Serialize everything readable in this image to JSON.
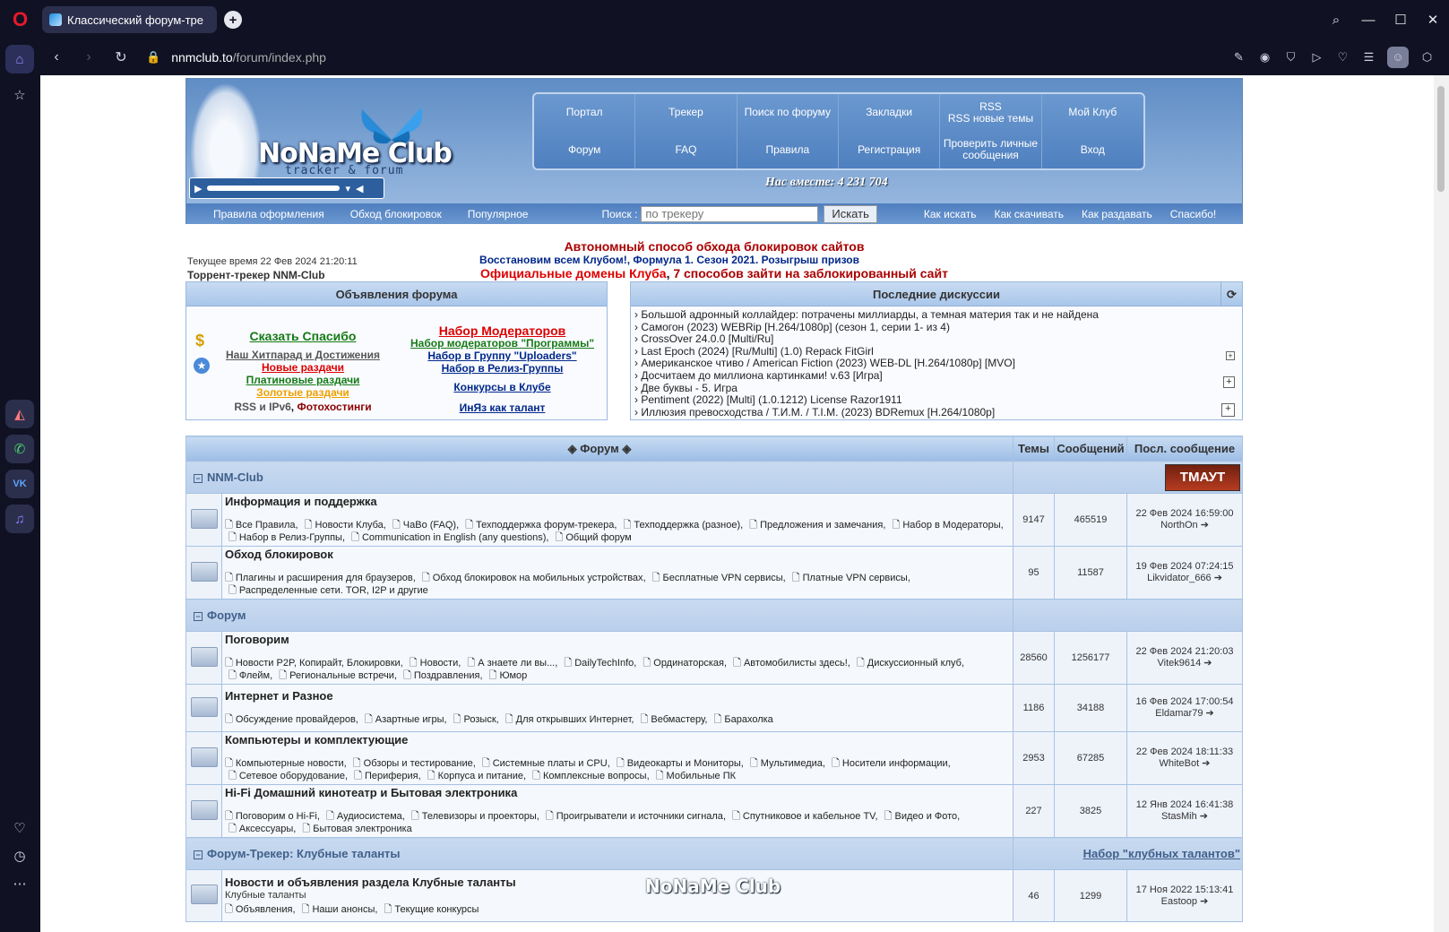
{
  "browser": {
    "tab_title": "Классический форум-тре",
    "url_host": "nnmclub.to",
    "url_path": "/forum/index.php",
    "new_tab": "+"
  },
  "header": {
    "logo": "NoNaMe Club",
    "logo_sub": "tracker & forum",
    "together": "Нас вместе: 4 231 704",
    "menu": [
      "Портал",
      "Трекер",
      "Поиск по форуму",
      "Закладки",
      "RSS\nRSS новые темы",
      "Мой Клуб",
      "Форум",
      "FAQ",
      "Правила",
      "Регистрация",
      "Проверить личные сообщения",
      "Вход"
    ],
    "subnav": [
      "Правила оформления",
      "Обход блокировок",
      "Популярное"
    ],
    "search_label": "Поиск :",
    "search_placeholder": "по трекеру",
    "search_btn": "Искать",
    "subnav_right": [
      "Как искать",
      "Как скачивать",
      "Как раздавать",
      "Спасибо!"
    ]
  },
  "info": {
    "time": "Текущее время 22 Фев 2024 21:20:11",
    "tracker": "Торрент-трекер NNM-Club",
    "ann1": "Автономный способ обхода блокировок сайтов",
    "ann2a": "Восстановим всем Клубом!",
    "ann2b": "Формула 1. Сезон 2021. Розыгрыш призов",
    "ann3a": "Официальные домены Клуба",
    "ann3b": "7 способов зайти на заблокированный сайт"
  },
  "announce": {
    "title": "Объявления форума",
    "col1": [
      "Сказать Спасибо",
      "Наш Хитпарад и Достижения",
      "Новые раздачи",
      "Платиновые раздачи",
      "Золотые раздачи"
    ],
    "rss": "RSS и IPv6",
    "photo": "Фотохостинги",
    "col2": [
      "Набор Модераторов",
      "Набор модераторов \"Программы\"",
      "Набор в Группу \"Uploaders\"",
      "Набор в Релиз-Группы",
      "Конкурсы в Клубе",
      "ИнЯз как талант"
    ]
  },
  "discussions": {
    "title": "Последние дискуссии",
    "items": [
      "Большой адронный коллайдер: потрачены миллиарды, а темная материя так и не найдена",
      "Самогон (2023) WEBRip [H.264/1080p] (сезон 1, серии 1- из 4)",
      "CrossOver 24.0.0 [Multi/Ru]",
      "Last Epoch (2024) [Ru/Multi] (1.0) Repack FitGirl",
      "Американское чтиво / American Fiction (2023) WEB-DL [H.264/1080p] [MVO]",
      "Досчитаем до миллиона картинками! v.63 [Игра]",
      "Две буквы - 5. Игра",
      "Pentiment (2022) [Multi] (1.0.1212) License Razor1911",
      "Иллюзия превосходства / Т.И.М. / T.I.M. (2023) BDRemux [H.264/1080p]"
    ]
  },
  "forum": {
    "col_forum": "Форум",
    "col_topics": "Темы",
    "col_posts": "Сообщений",
    "col_last": "Посл. сообщение",
    "cat1": "NNM-Club",
    "cat1_badge": "ТМАУТ",
    "cat2": "Форум",
    "cat3": "Форум-Трекер: Клубные таланты",
    "cat3_link": "Набор \"клубных талантов\"",
    "rows": [
      {
        "title": "Информация и поддержка",
        "subs": [
          "Все Правила",
          "Новости Клуба",
          "ЧаВо (FAQ)",
          "Техподдержка форум-трекера",
          "Техподдержка (разное)",
          "Предложения и замечания",
          "Набор в Модераторы",
          "Набор в Релиз-Группы",
          "Communication in English (any questions)",
          "Общий форум"
        ],
        "topics": "9147",
        "posts": "465519",
        "last_date": "22 Фев 2024 16:59:00",
        "last_user": "NorthOn"
      },
      {
        "title": "Обход блокировок",
        "subs": [
          "Плагины и расширения для браузеров",
          "Обход блокировок на мобильных устройствах",
          "Бесплатные VPN сервисы",
          "Платные VPN сервисы",
          "Распределенные сети. TOR, I2P и другие"
        ],
        "topics": "95",
        "posts": "11587",
        "last_date": "19 Фев 2024 07:24:15",
        "last_user": "Likvidator_666"
      },
      {
        "title": "Поговорим",
        "subs": [
          "Новости P2P, Копирайт, Блокировки",
          "Новости",
          "А знаете ли вы...",
          "DailyTechInfo",
          "Ординаторская",
          "Автомобилисты здесь!",
          "Дискуссионный клуб",
          "Флейм",
          "Региональные встречи",
          "Поздравления",
          "Юмор"
        ],
        "topics": "28560",
        "posts": "1256177",
        "last_date": "22 Фев 2024 21:20:03",
        "last_user": "Vitek9614"
      },
      {
        "title": "Интернет и Разное",
        "subs": [
          "Обсуждение провайдеров",
          "Азартные игры",
          "Розыск",
          "Для открывших Интернет",
          "Вебмастеру",
          "Барахолка"
        ],
        "topics": "1186",
        "posts": "34188",
        "last_date": "16 Фев 2024 17:00:54",
        "last_user": "Eldamar79"
      },
      {
        "title": "Компьютеры и комплектующие",
        "subs": [
          "Компьютерные новости",
          "Обзоры и тестирование",
          "Системные платы и CPU",
          "Видеокарты и Мониторы",
          "Мультимедиа",
          "Носители информации",
          "Сетевое оборудование",
          "Периферия",
          "Корпуса и питание",
          "Комплексные вопросы",
          "Мобильные ПК"
        ],
        "topics": "2953",
        "posts": "67285",
        "last_date": "22 Фев 2024 18:11:33",
        "last_user": "WhiteBot"
      },
      {
        "title": "Hi-Fi Домашний кинотеатр и Бытовая электроника",
        "subs": [
          "Поговорим о Hi-Fi",
          "Аудиосистема",
          "Телевизоры и проекторы",
          "Проигрыватели и источники сигнала",
          "Спутниковое и кабельное TV",
          "Видео и Фото",
          "Аксессуары",
          "Бытовая электроника"
        ],
        "topics": "227",
        "posts": "3825",
        "last_date": "12 Янв 2024 16:41:38",
        "last_user": "StasMih"
      },
      {
        "title": "Новости и объявления раздела Клубные таланты",
        "small": "Клубные таланты",
        "subs": [
          "Объявления",
          "Наши анонсы",
          "Текущие конкурсы"
        ],
        "topics": "46",
        "posts": "1299",
        "last_date": "17 Ноя 2022 15:13:41",
        "last_user": "Eastoop"
      }
    ]
  },
  "watermark": "NoNaMe Club"
}
